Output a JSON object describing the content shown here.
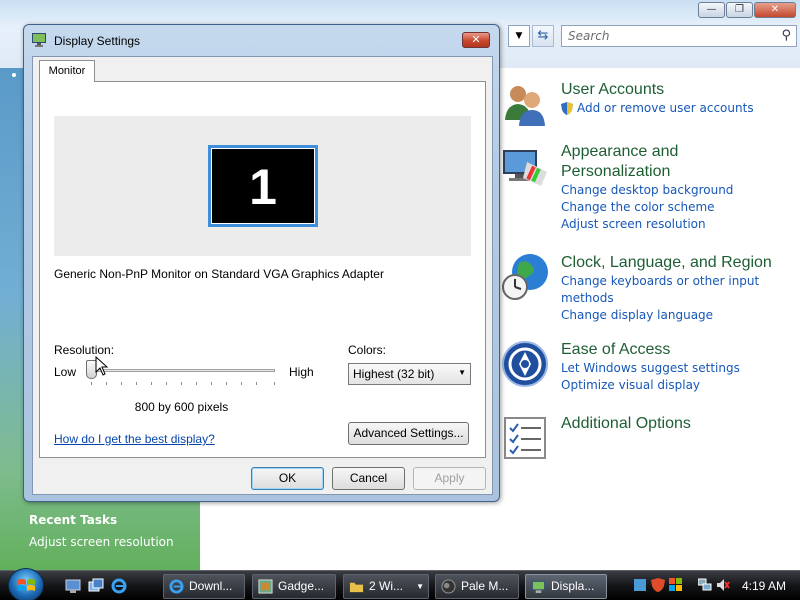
{
  "control_panel": {
    "search_placeholder": "Search",
    "categories": [
      {
        "title": "User Accounts",
        "links": [
          "Add or remove user accounts"
        ]
      },
      {
        "title": "Appearance and",
        "title2": "Personalization",
        "links": [
          "Change desktop background",
          "Change the color scheme",
          "Adjust screen resolution"
        ]
      },
      {
        "title": "Clock, Language, and Region",
        "links": [
          "Change keyboards or other input",
          "methods",
          "Change display language"
        ]
      },
      {
        "title": "Ease of Access",
        "links": [
          "Let Windows suggest settings",
          "Optimize visual display"
        ]
      },
      {
        "title": "Additional Options",
        "links": []
      }
    ],
    "recent_tasks": {
      "title": "Recent Tasks",
      "link": "Adjust screen resolution"
    }
  },
  "dialog": {
    "title": "Display Settings",
    "close_label": "✕",
    "tab": "Monitor",
    "monitor_number": "1",
    "monitor_description": "Generic Non-PnP Monitor on Standard VGA Graphics Adapter",
    "resolution_label": "Resolution:",
    "low_label": "Low",
    "high_label": "High",
    "resolution_value": "800 by 600 pixels",
    "colors_label": "Colors:",
    "colors_value": "Highest (32 bit)",
    "help_link": "How do I get the best display?",
    "advanced_button": "Advanced Settings...",
    "ok_button": "OK",
    "cancel_button": "Cancel",
    "apply_button": "Apply"
  },
  "taskbar": {
    "buttons": [
      {
        "label": "Downl..."
      },
      {
        "label": "Gadge..."
      },
      {
        "label": "2 Wi..."
      },
      {
        "label": "Pale M..."
      },
      {
        "label": "Displa..."
      }
    ],
    "clock": "4:19 AM"
  },
  "colors": {
    "link_blue": "#1657b8",
    "category_green": "#1e5e33",
    "dialog_frame": "#aac3df",
    "close_red": "#c9482f",
    "monitor_highlight": "#3f8fdb"
  }
}
